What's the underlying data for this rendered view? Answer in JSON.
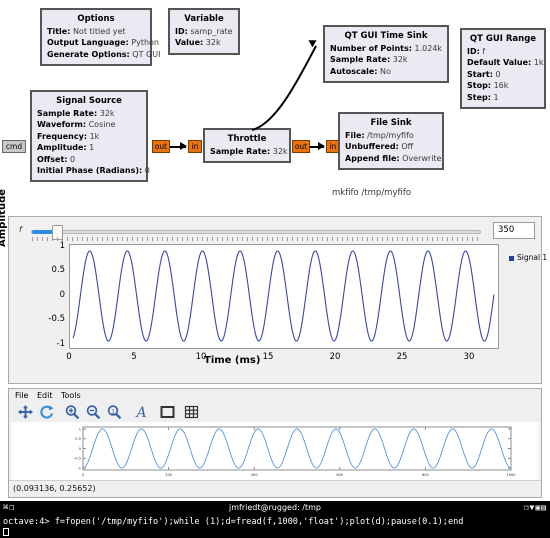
{
  "flowgraph": {
    "blocks": [
      {
        "id": "options",
        "title": "Options",
        "rows": [
          {
            "key": "Title:",
            "val": "Not titled yet"
          },
          {
            "key": "Output Language:",
            "val": "Python"
          },
          {
            "key": "Generate Options:",
            "val": "QT GUI"
          }
        ]
      },
      {
        "id": "variable",
        "title": "Variable",
        "rows": [
          {
            "key": "ID:",
            "val": "samp_rate"
          },
          {
            "key": "Value:",
            "val": "32k"
          }
        ]
      },
      {
        "id": "signal_source",
        "title": "Signal Source",
        "rows": [
          {
            "key": "Sample Rate:",
            "val": "32k"
          },
          {
            "key": "Waveform:",
            "val": "Cosine"
          },
          {
            "key": "Frequency:",
            "val": "1k"
          },
          {
            "key": "Amplitude:",
            "val": "1"
          },
          {
            "key": "Offset:",
            "val": "0"
          },
          {
            "key": "Initial Phase (Radians):",
            "val": "0"
          }
        ]
      },
      {
        "id": "throttle",
        "title": "Throttle",
        "rows": [
          {
            "key": "Sample Rate:",
            "val": "32k"
          }
        ]
      },
      {
        "id": "qt_gui_time_sink",
        "title": "QT GUI Time Sink",
        "rows": [
          {
            "key": "Number of Points:",
            "val": "1.024k"
          },
          {
            "key": "Sample Rate:",
            "val": "32k"
          },
          {
            "key": "Autoscale:",
            "val": "No"
          }
        ]
      },
      {
        "id": "qt_gui_range",
        "title": "QT GUI Range",
        "rows": [
          {
            "key": "ID:",
            "val": "f"
          },
          {
            "key": "Default Value:",
            "val": "1k"
          },
          {
            "key": "Start:",
            "val": "0"
          },
          {
            "key": "Stop:",
            "val": "16k"
          },
          {
            "key": "Step:",
            "val": "1"
          }
        ]
      },
      {
        "id": "file_sink",
        "title": "File Sink",
        "rows": [
          {
            "key": "File:",
            "val": "/tmp/myfifo"
          },
          {
            "key": "Unbuffered:",
            "val": "Off"
          },
          {
            "key": "Append file:",
            "val": "Overwrite"
          }
        ]
      }
    ],
    "ports": {
      "cmd": "cmd",
      "out": "out",
      "in": "in"
    },
    "caption": "mkfifo /tmp/myfifo"
  },
  "qtgui": {
    "slider_label": "f",
    "slider_value": "350",
    "legend_label": "Signal 1",
    "accent_color": "#2b8ce0",
    "trace_color": "#3a47a8"
  },
  "chart_data": {
    "type": "line",
    "title": "",
    "xlabel": "Time (ms)",
    "ylabel": "Amplitude",
    "xlim": [
      0,
      32
    ],
    "ylim": [
      -1.1,
      1.1
    ],
    "xticks": [
      0,
      5,
      10,
      15,
      20,
      25,
      30
    ],
    "yticks": [
      -1,
      -0.5,
      0,
      0.5,
      1
    ],
    "grid": false,
    "legend": [
      "Signal 1"
    ],
    "legend_position": "right",
    "series": [
      {
        "name": "Signal 1",
        "waveform": "cosine",
        "amplitude": 1,
        "frequency_hz": 350,
        "period_ms": 2.857,
        "phase_deg": 200,
        "cycles_visible": 11.2
      }
    ]
  },
  "octave_window": {
    "menu": [
      "File",
      "Edit",
      "Tools"
    ],
    "toolbar_icons": [
      "pan-icon",
      "refresh-icon",
      "zoom-in-icon",
      "zoom-out-icon",
      "zoom-reset-icon",
      "text-tool-icon",
      "box-tool-icon",
      "grid-icon"
    ],
    "status_coords": "(0.093136, 0.25652)",
    "figure": {
      "type": "line",
      "xlim": [
        0,
        1000
      ],
      "ylim": [
        -1.1,
        1.1
      ],
      "xticks": [
        0,
        200,
        400,
        600,
        800,
        1000
      ],
      "yticks": [
        -1,
        -0.5,
        0,
        0.5,
        1
      ],
      "grid": false,
      "trace_color": "#4a90d9",
      "series": [
        {
          "name": "d",
          "waveform": "cosine",
          "amplitude": 1,
          "samples": 1000,
          "cycles_visible": 11
        }
      ]
    }
  },
  "terminal": {
    "title": "jmfriedt@rugged: /tmp",
    "left_glyphs": "⌘❐",
    "right_glyphs": "❐▼▣▤",
    "prompt": "octave:4>",
    "command": "f=fopen('/tmp/myfifo');while (1);d=fread(f,1000,'float');plot(d);pause(0.1);end"
  }
}
